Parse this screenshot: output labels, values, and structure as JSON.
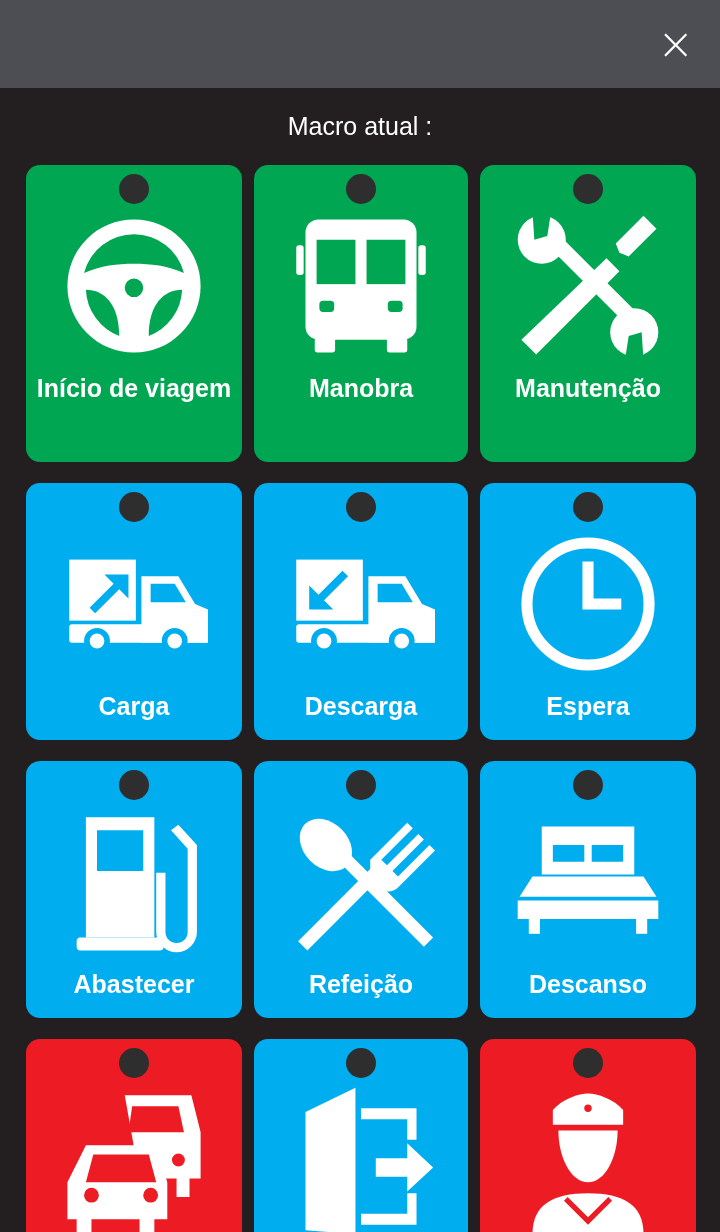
{
  "header": {
    "close": "×"
  },
  "title": "Macro atual :",
  "macros": [
    {
      "label": "Início de viagem",
      "color": "#00a651"
    },
    {
      "label": "Manobra",
      "color": "#00a651"
    },
    {
      "label": "Manutenção",
      "color": "#00a651"
    },
    {
      "label": "Carga",
      "color": "#00aeef"
    },
    {
      "label": "Descarga",
      "color": "#00aeef"
    },
    {
      "label": "Espera",
      "color": "#00aeef"
    },
    {
      "label": "Abastecer",
      "color": "#00aeef"
    },
    {
      "label": "Refeição",
      "color": "#00aeef"
    },
    {
      "label": "Descanso",
      "color": "#00aeef"
    },
    {
      "color": "#ed1c24"
    },
    {
      "color": "#00aeef"
    },
    {
      "color": "#ed1c24"
    }
  ]
}
